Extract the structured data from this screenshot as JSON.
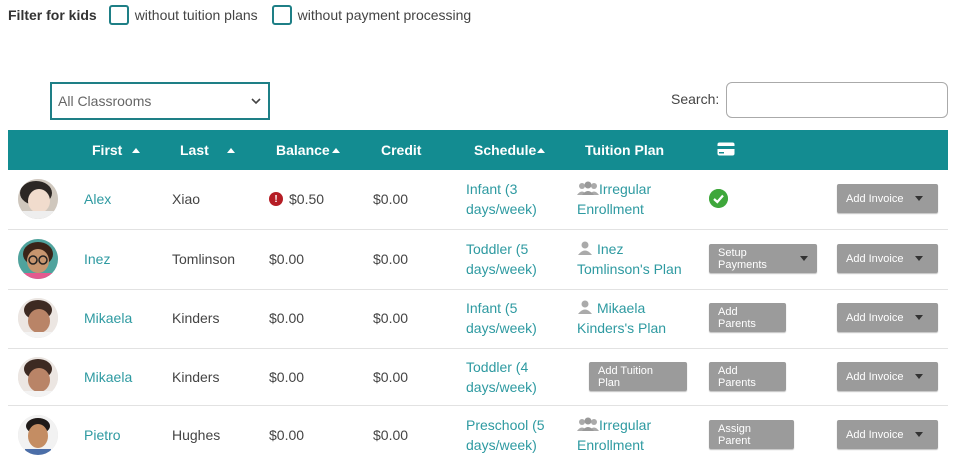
{
  "filters": {
    "label": "Filter for kids",
    "options": [
      "without tuition plans",
      "without payment processing"
    ]
  },
  "classroom_select": {
    "value": "All Classrooms"
  },
  "search": {
    "label": "Search:",
    "value": ""
  },
  "table": {
    "headers": {
      "first": "First",
      "last": "Last",
      "balance": "Balance",
      "credit": "Credit",
      "schedule": "Schedule",
      "tuition_plan": "Tuition Plan",
      "payment": "credit-card-icon"
    },
    "rows": [
      {
        "first": "Alex",
        "last": "Xiao",
        "balance": "$0.50",
        "balance_warning": true,
        "credit": "$0.00",
        "schedule_1": "Infant (3",
        "schedule_2": "days/week)",
        "plan_1": "Irregular",
        "plan_2": "Enrollment",
        "plan_icon": "group-icon",
        "payment_status": "check-circle-icon",
        "invoice": "Add Invoice"
      },
      {
        "first": "Inez",
        "last": "Tomlinson",
        "balance": "$0.00",
        "credit": "$0.00",
        "schedule_1": "Toddler (5",
        "schedule_2": "days/week)",
        "plan_1": "Inez",
        "plan_2": "Tomlinson's Plan",
        "plan_icon": "person-icon",
        "payment_button": "Setup Payments",
        "invoice": "Add Invoice"
      },
      {
        "first": "Mikaela",
        "last": "Kinders",
        "balance": "$0.00",
        "credit": "$0.00",
        "schedule_1": "Infant (5",
        "schedule_2": "days/week)",
        "plan_1": "Mikaela",
        "plan_2": "Kinders's Plan",
        "plan_icon": "person-icon",
        "payment_button": "Add Parents",
        "invoice": "Add Invoice"
      },
      {
        "first": "Mikaela",
        "last": "Kinders",
        "balance": "$0.00",
        "credit": "$0.00",
        "schedule_1": "Toddler (4",
        "schedule_2": "days/week)",
        "plan_button": "Add Tuition Plan",
        "payment_button": "Add Parents",
        "invoice": "Add Invoice"
      },
      {
        "first": "Pietro",
        "last": "Hughes",
        "balance": "$0.00",
        "credit": "$0.00",
        "schedule_1": "Preschool (5",
        "schedule_2": "days/week)",
        "plan_1": "Irregular",
        "plan_2": "Enrollment",
        "plan_icon": "group-icon",
        "payment_button": "Assign Parent",
        "invoice": "Add Invoice"
      }
    ]
  },
  "colors": {
    "accent": "#138c91",
    "link": "#2e9aa1",
    "button": "#9b9b9b",
    "warning": "#b51d25",
    "success": "#3ea73b"
  }
}
